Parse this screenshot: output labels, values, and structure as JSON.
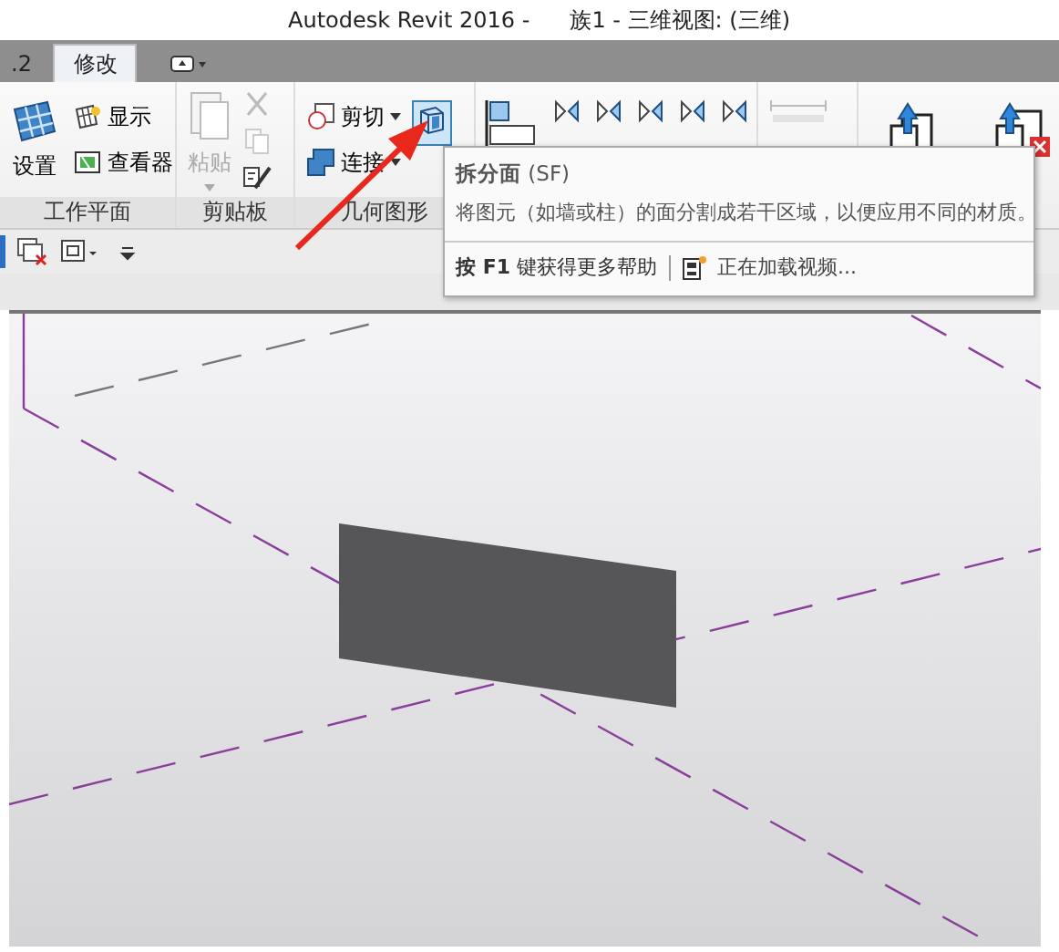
{
  "window": {
    "title": "Autodesk Revit 2016 -",
    "document": "族1 - 三维视图: (三维)"
  },
  "tabs": [
    {
      "label": ".2",
      "selected": false
    },
    {
      "label": "修改",
      "selected": true
    }
  ],
  "panels": [
    {
      "label": "工作平面",
      "buttons": [
        {
          "label": "设置"
        },
        {
          "label": "显示"
        },
        {
          "label": "查看器"
        }
      ]
    },
    {
      "label": "剪贴板",
      "buttons": [
        {
          "label": "粘贴",
          "disabled": true
        }
      ]
    },
    {
      "label": "几何图形",
      "buttons": [
        {
          "label": "剪切"
        },
        {
          "label": "连接"
        },
        {
          "selected": true
        }
      ]
    }
  ],
  "tooltip": {
    "title": "拆分面",
    "shortcut": "(SF)",
    "description": "将图元（如墙或柱）的面分割成若干区域，以便应用不同的材质。",
    "help_prefix": "按",
    "help_key": "F1",
    "help_suffix": "键获得更多帮助",
    "video": "正在加载视频..."
  }
}
